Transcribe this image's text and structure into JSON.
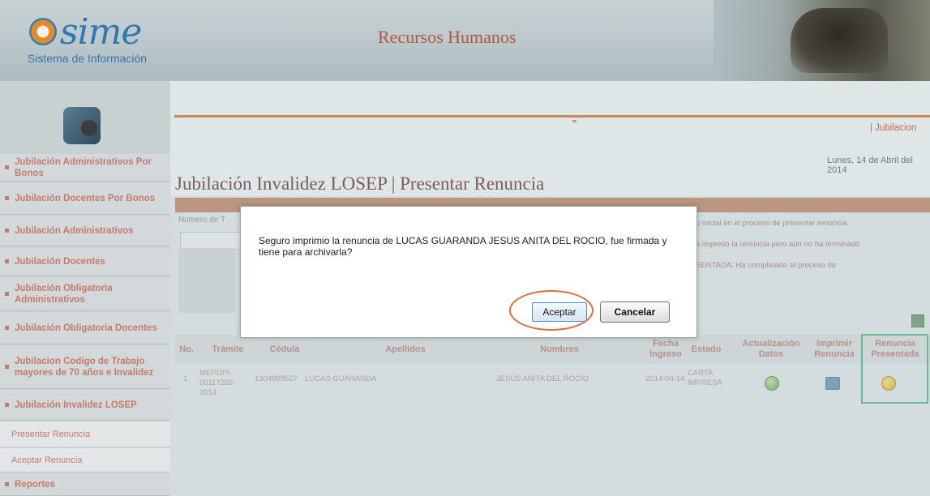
{
  "header": {
    "logo_word": "sime",
    "logo_subtitle": "Sistema de Información",
    "app_title": "Recursos Humanos"
  },
  "sidebar": {
    "items": [
      {
        "label": "Jubilación Administrativos Por Bonos"
      },
      {
        "label": "Jubilación Docentes Por Bonos"
      },
      {
        "label": "Jubilación Administrativos"
      },
      {
        "label": "Jubilación Docentes"
      },
      {
        "label": "Jubilación Obligatoria Administrativos"
      },
      {
        "label": "Jubilación Obligatoria Docentes"
      },
      {
        "label": "Jubilacion Codigo de Trabajo mayores de 70 años e Invalidez"
      },
      {
        "label": "Jubilación Invalidez LOSEP"
      }
    ],
    "subitems": [
      {
        "label": "Presentar Renuncia"
      },
      {
        "label": "Aceptar Renuncia"
      }
    ],
    "last_item": {
      "label": "Reportes"
    }
  },
  "main": {
    "top_link": "| Jubilacion",
    "date": "Lunes, 14 de Abril del 2014",
    "page_title": "Jubilación Invalidez LOSEP | Presentar Renuncia",
    "search_label": "Numero de T",
    "info_lines": [
      "o inicial en el proceso de presentar renuncia.",
      "a impreso la renuncia pero aún no ha terminado",
      "SENTADA: Ha completado el proceso de"
    ],
    "table": {
      "headers": {
        "no": "No.",
        "tramite": "Trámite",
        "cedula": "Cédula",
        "apellidos": "Apellidos",
        "nombres": "Nombres",
        "fecha": "Fecha Ingreso",
        "estado": "Estado",
        "actualizacion": "Actualización Datos",
        "imprimir": "Imprimir Renuncia",
        "renuncia": "Renuncia Presentada"
      },
      "rows": [
        {
          "no": "1",
          "tramite": "MEPOPI-00117282-2014",
          "cedula": "1304998527",
          "apellidos": "LUCAS GUARANDA",
          "nombres": "JESUS ANITA DEL ROCIO",
          "fecha": "2014-04-14",
          "estado": "CARTA IMPRESA"
        }
      ]
    }
  },
  "dialog": {
    "message": "Seguro imprimio la renuncia de LUCAS GUARANDA JESUS ANITA DEL ROCIO, fue firmada y tiene para archivarla?",
    "accept_label": "Aceptar",
    "cancel_label": "Cancelar"
  },
  "colors": {
    "brand_blue": "#2e79ad",
    "accent_orange": "#b87c55",
    "sidebar_text": "#c67a6a",
    "highlight_green": "#3fb36a",
    "annotation_red": "#e06a3d"
  },
  "icons": {
    "actualizar": "check-circle-icon",
    "imprimir": "printer-icon",
    "renuncia": "pending-circle-icon",
    "excel": "excel-icon"
  }
}
